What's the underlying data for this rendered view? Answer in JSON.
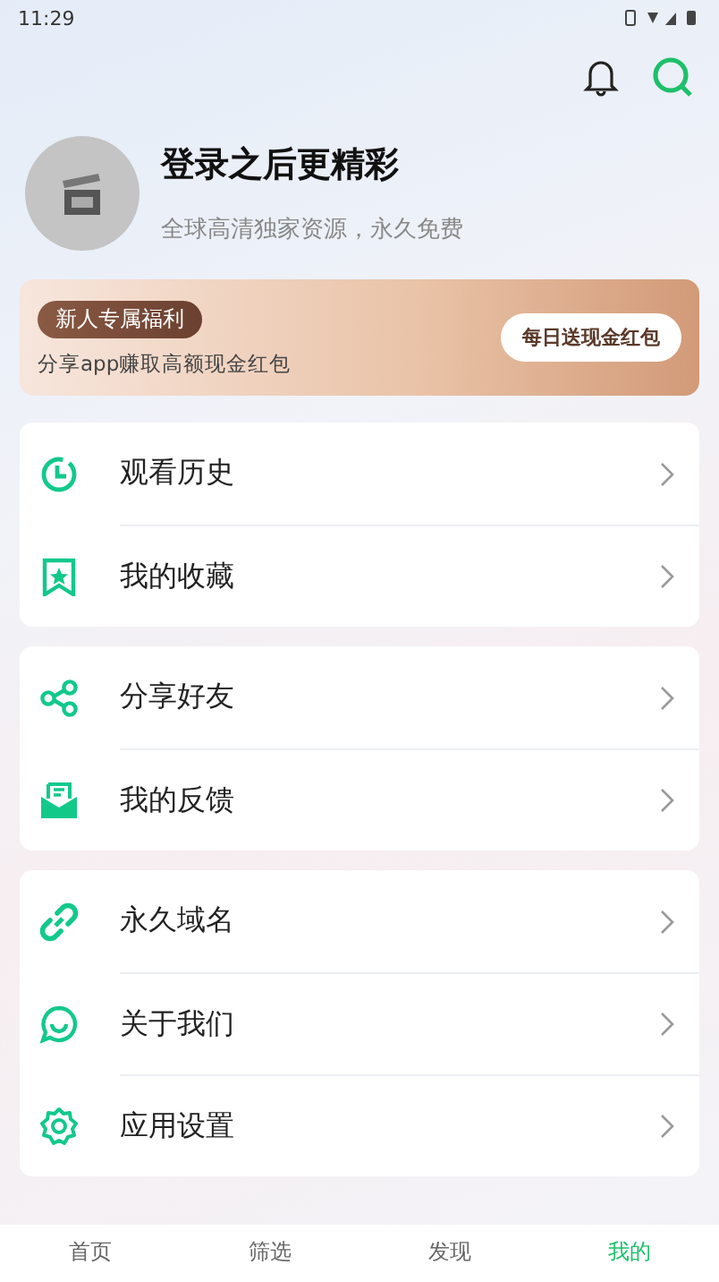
{
  "status_bar": {
    "time": "11:29"
  },
  "profile": {
    "title": "登录之后更精彩",
    "subtitle": "全球高清独家资源，永久免费"
  },
  "banner": {
    "badge": "新人专属福利",
    "text": "分享app赚取高额现金红包",
    "button": "每日送现金红包"
  },
  "menu_groups": [
    {
      "items": [
        {
          "label": "观看历史"
        },
        {
          "label": "我的收藏"
        }
      ]
    },
    {
      "items": [
        {
          "label": "分享好友"
        },
        {
          "label": "我的反馈"
        }
      ]
    },
    {
      "items": [
        {
          "label": "永久域名"
        },
        {
          "label": "关于我们"
        },
        {
          "label": "应用设置"
        }
      ]
    }
  ],
  "tab_bar": [
    {
      "label": "首页",
      "selected": false
    },
    {
      "label": "筛选",
      "selected": false
    },
    {
      "label": "发现",
      "selected": false
    },
    {
      "label": "我的",
      "selected": true
    }
  ]
}
